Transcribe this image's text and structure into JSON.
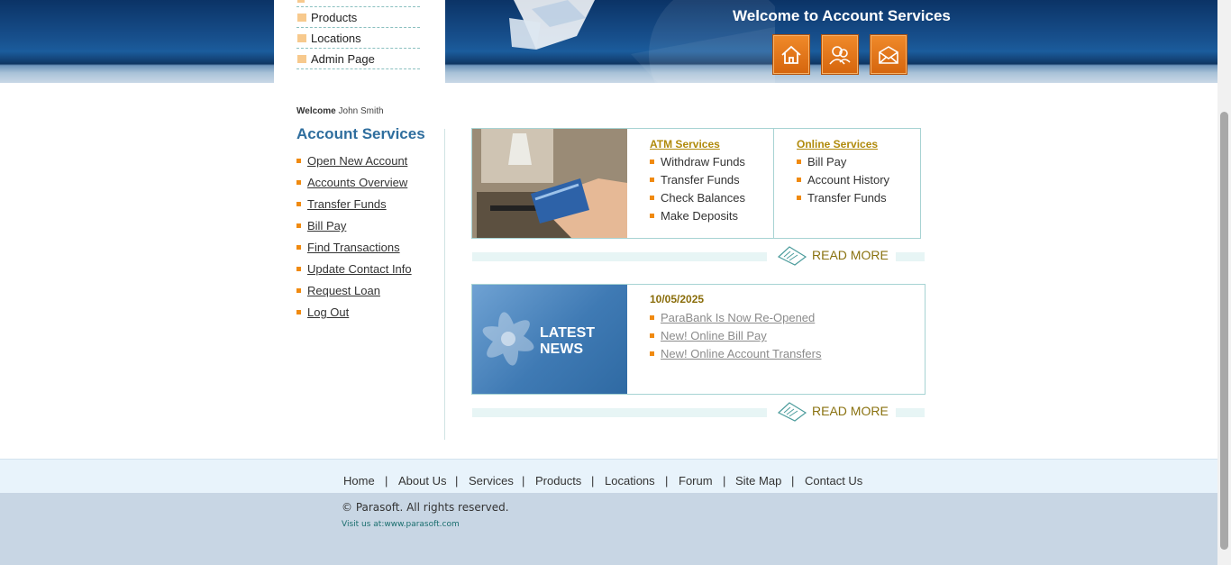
{
  "header": {
    "title": "Welcome to Account Services",
    "buttons": [
      {
        "icon": "home-icon"
      },
      {
        "icon": "about-icon"
      },
      {
        "icon": "contact-icon"
      }
    ]
  },
  "top_menu": [
    {
      "label": "Products"
    },
    {
      "label": "Locations"
    },
    {
      "label": "Admin Page"
    }
  ],
  "user": {
    "welcome_label": "Welcome",
    "name": "John Smith"
  },
  "account_services": {
    "title": "Account Services",
    "items": [
      "Open New Account",
      "Accounts Overview",
      "Transfer Funds",
      "Bill Pay",
      "Find Transactions",
      "Update Contact Info",
      "Request Loan",
      "Log Out"
    ]
  },
  "services_panel": {
    "atm": {
      "title": "ATM Services",
      "items": [
        "Withdraw Funds",
        "Transfer Funds",
        "Check Balances",
        "Make Deposits"
      ]
    },
    "online": {
      "title": "Online Services",
      "items": [
        "Bill Pay",
        "Account History",
        "Transfer Funds"
      ]
    },
    "read_more": "READ MORE"
  },
  "news_panel": {
    "image_text_line1": "LATEST",
    "image_text_line2": "NEWS",
    "date": "10/05/2025",
    "items": [
      "ParaBank Is Now Re-Opened",
      "New! Online Bill Pay",
      "New! Online Account Transfers"
    ],
    "read_more": "READ MORE"
  },
  "footer": {
    "links": [
      "Home",
      "About Us",
      "Services",
      "Products",
      "Locations",
      "Forum",
      "Site Map",
      "Contact Us"
    ],
    "separator": "|",
    "copyright": "© Parasoft. All rights reserved.",
    "visit": "Visit us at:www.parasoft.com"
  },
  "colors": {
    "accent_orange": "#e27a1c",
    "link_gold": "#b08a0b",
    "title_blue": "#2f6e9e"
  }
}
